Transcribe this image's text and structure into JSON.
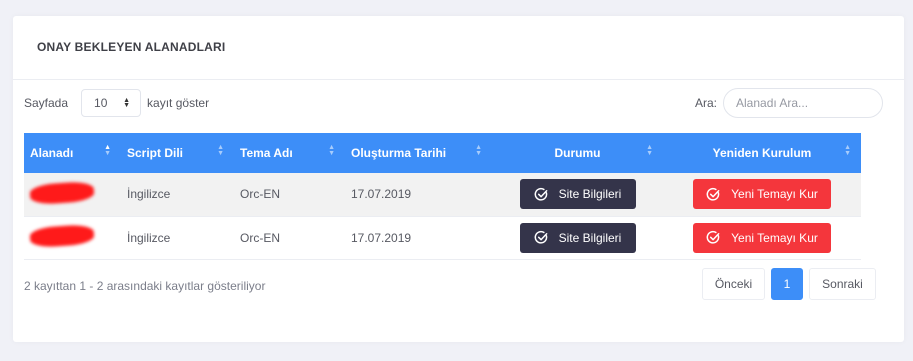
{
  "card": {
    "title": "ONAY BEKLEYEN ALANADLARI"
  },
  "length": {
    "prefix": "Sayfada",
    "value": "10",
    "suffix": "kayıt göster"
  },
  "search": {
    "label": "Ara:",
    "placeholder": "Alanadı Ara..."
  },
  "table": {
    "headers": [
      "Alanadı",
      "Script Dili",
      "Tema Adı",
      "Oluşturma Tarihi",
      "Durumu",
      "Yeniden Kurulum"
    ],
    "sorted_column": "Alanadı",
    "rows": [
      {
        "domain": "",
        "script": "İngilizce",
        "theme": "Orc-EN",
        "date": "17.07.2019",
        "status_button": "Site Bilgileri",
        "reinstall_button": "Yeni Temayı Kur"
      },
      {
        "domain": "",
        "script": "İngilizce",
        "theme": "Orc-EN",
        "date": "17.07.2019",
        "status_button": "Site Bilgileri",
        "reinstall_button": "Yeni Temayı Kur"
      }
    ]
  },
  "info": "2 kayıttan 1 - 2 arasındaki kayıtlar gösteriliyor",
  "pagination": {
    "prev": "Önceki",
    "current": "1",
    "next": "Sonraki"
  },
  "colors": {
    "header_bg": "#3d8ef8",
    "dark_button": "#34344a",
    "red_button": "#f4363c",
    "redaction": "#ff1a1a"
  },
  "icons": {
    "button_icon": "check-circle-icon",
    "sort_icon": "sort-arrows-icon"
  }
}
